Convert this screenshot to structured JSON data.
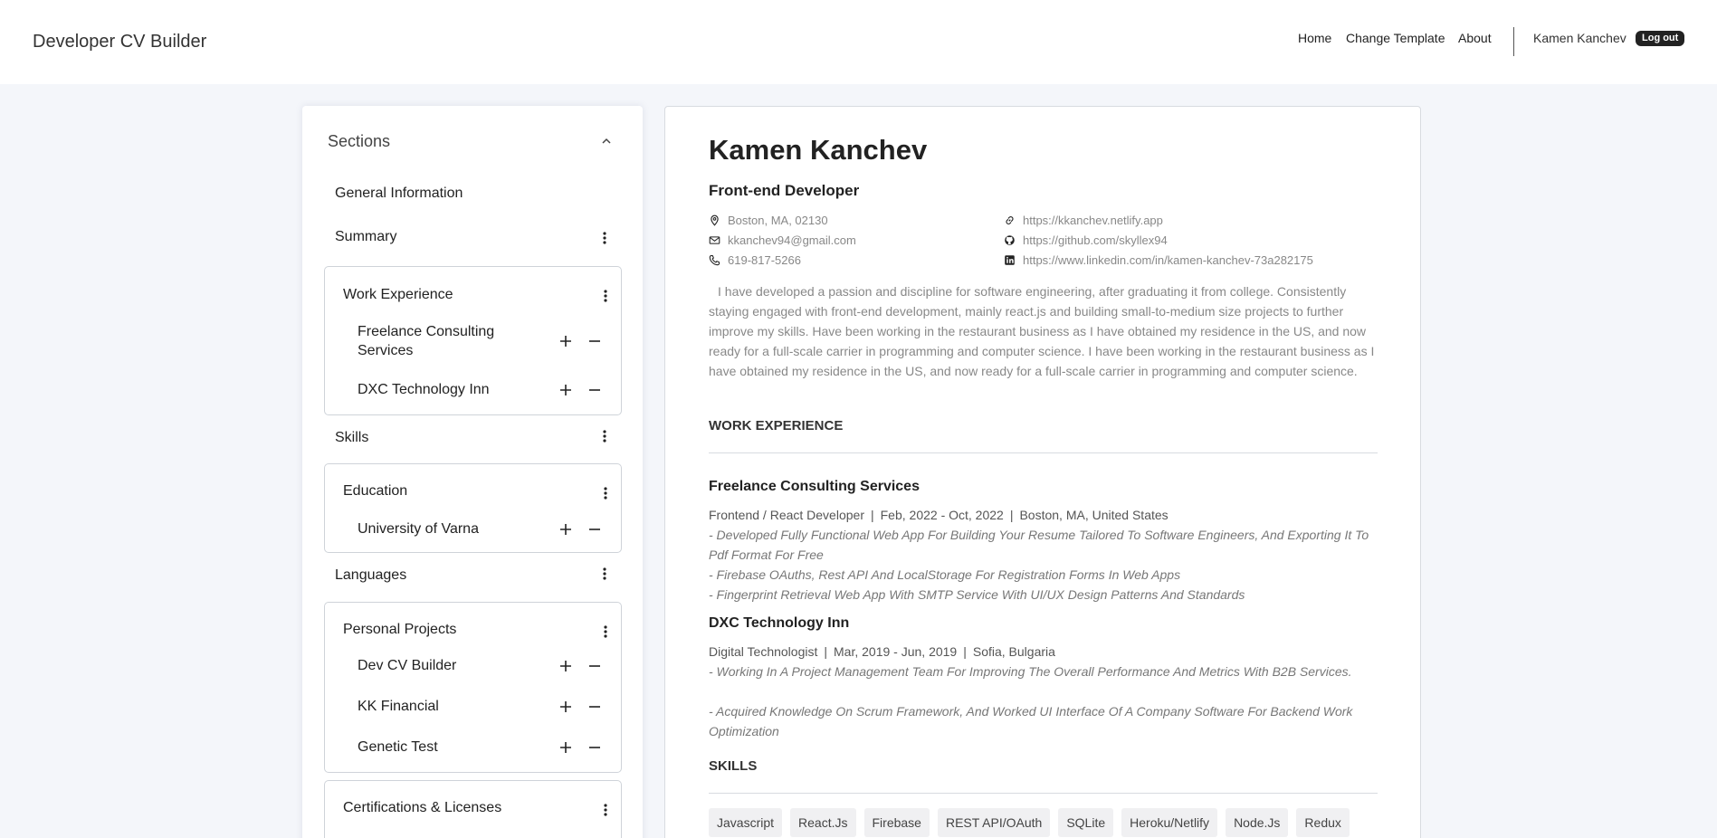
{
  "header": {
    "brand": "Developer CV Builder",
    "nav": [
      "Home",
      "Change Template",
      "About"
    ],
    "user": "Kamen Kanchev",
    "logout": "Log out"
  },
  "sidebar": {
    "title": "Sections",
    "general": "General Information",
    "summary": "Summary",
    "work": {
      "title": "Work Experience",
      "items": [
        "Freelance Consulting Services",
        "DXC Technology Inn"
      ]
    },
    "skills": "Skills",
    "education": {
      "title": "Education",
      "items": [
        "University of Varna"
      ]
    },
    "languages": "Languages",
    "projects": {
      "title": "Personal Projects",
      "items": [
        "Dev CV Builder",
        "KK Financial",
        "Genetic Test"
      ]
    },
    "certs": {
      "title": "Certifications & Licenses"
    }
  },
  "resume": {
    "name": "Kamen Kanchev",
    "role": "Front-end Developer",
    "contacts": {
      "location": "Boston, MA, 02130",
      "email": "kkanchev94@gmail.com",
      "phone": "619-817-5266",
      "website": "https://kkanchev.netlify.app",
      "github": "https://github.com/skyllex94",
      "linkedin": "https://www.linkedin.com/in/kamen-kanchev-73a282175"
    },
    "summary": "I have developed a passion and discipline for software engineering, after graduating it from college. Consistently staying engaged with front-end development, mainly react.js and building small-to-medium size projects to further improve my skills. Have been working in the restaurant business as I have obtained my residence in the US, and now ready for a full-scale carrier in programming and computer science. I have been working in the restaurant business as I have obtained my residence in the US, and now ready for a full-scale carrier in programming and computer science.",
    "work_heading": "WORK EXPERIENCE",
    "jobs": [
      {
        "company": "Freelance Consulting Services",
        "title": "Frontend / React Developer",
        "dates": "Feb, 2022 - Oct, 2022",
        "location": "Boston, MA, United States",
        "bullets": [
          "- Developed Fully Functional Web App For Building Your Resume Tailored To Software Engineers, And Exporting It To Pdf Format For Free",
          "- Firebase OAuths, Rest API And LocalStorage For Registration Forms In Web Apps",
          "- Fingerprint Retrieval Web App With SMTP Service With UI/UX Design Patterns And Standards"
        ]
      },
      {
        "company": "DXC Technology Inn",
        "title": "Digital Technologist",
        "dates": "Mar, 2019 - Jun, 2019",
        "location": "Sofia, Bulgaria",
        "bullets": [
          "- Working In A Project Management Team For Improving The Overall Performance And Metrics With B2B Services.",
          "- Acquired Knowledge On Scrum Framework, And Worked UI Interface Of A Company Software For Backend Work Optimization"
        ]
      }
    ],
    "skills_heading": "SKILLS",
    "skills": [
      "Javascript",
      "React.Js",
      "Firebase",
      "REST API/OAuth",
      "SQLite",
      "Heroku/Netlify",
      "Node.Js",
      "Redux"
    ]
  }
}
